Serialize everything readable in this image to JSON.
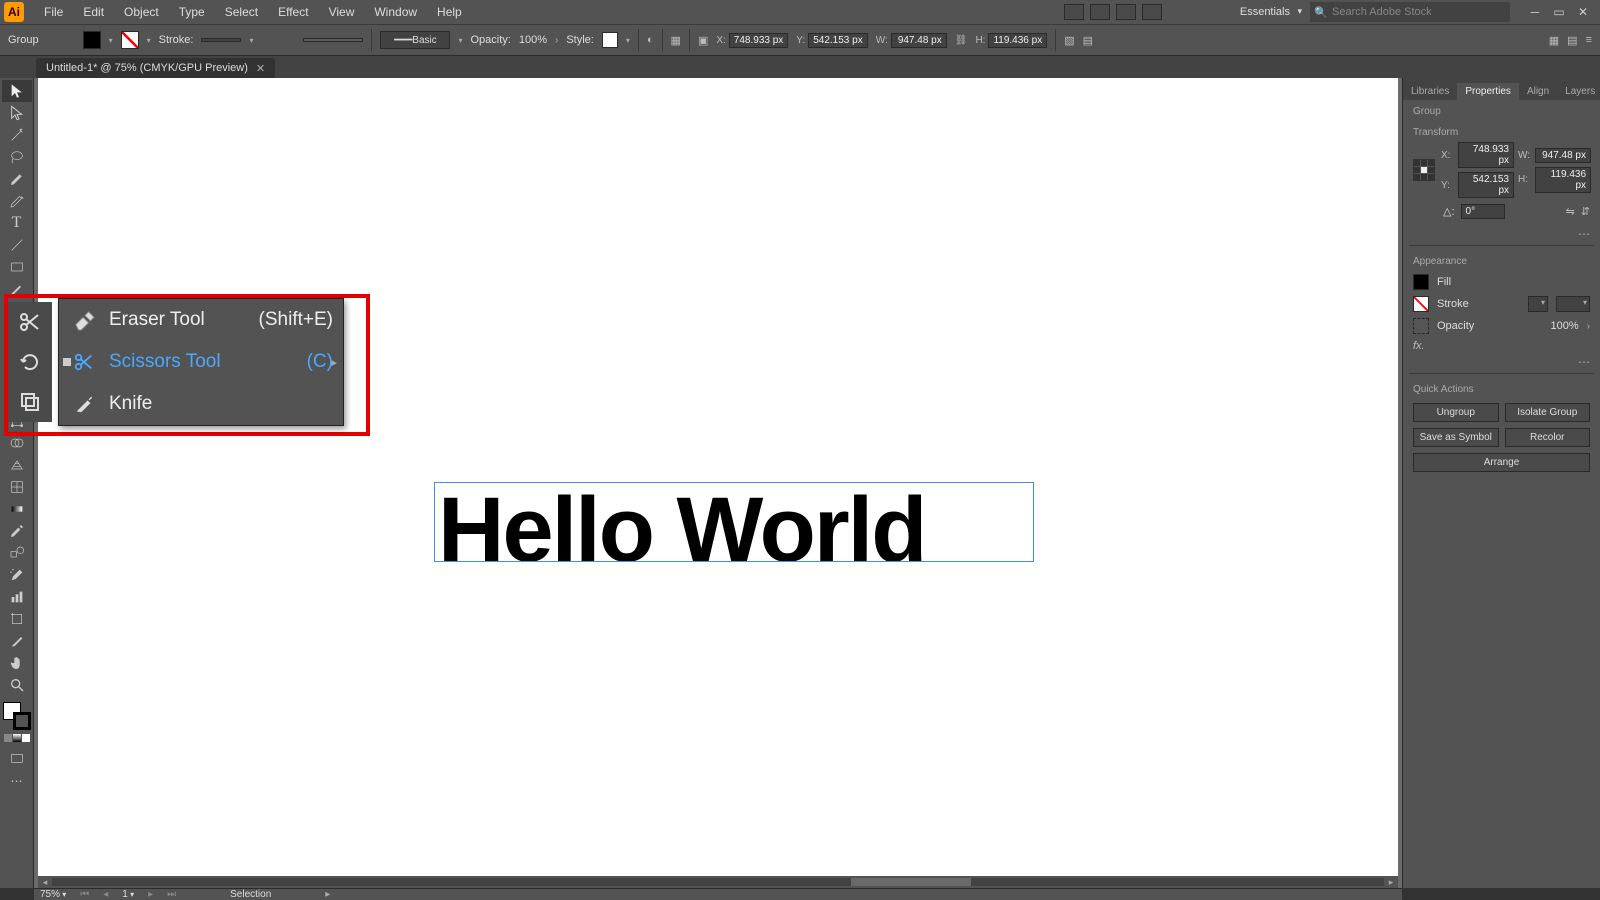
{
  "app_short": "Ai",
  "menu": [
    "File",
    "Edit",
    "Object",
    "Type",
    "Select",
    "Effect",
    "View",
    "Window",
    "Help"
  ],
  "workspace": "Essentials",
  "search_placeholder": "Search Adobe Stock",
  "control": {
    "selection_label": "Group",
    "stroke_label": "Stroke:",
    "stroke_weight": "",
    "brush_basic": "Basic",
    "opacity_label": "Opacity:",
    "opacity_value": "100%",
    "style_label": "Style:",
    "x_label": "X:",
    "y_label": "Y:",
    "w_label": "W:",
    "h_label": "H:",
    "x": "748.933 px",
    "y": "542.153 px",
    "w": "947.48 px",
    "h": "119.436 px"
  },
  "doc_tab": {
    "title": "Untitled-1* @ 75% (CMYK/GPU Preview)"
  },
  "canvas_text": "Hello World",
  "status": {
    "zoom": "75%",
    "artboard_num": "1",
    "tool": "Selection"
  },
  "flyout": {
    "items": [
      {
        "name": "Eraser Tool",
        "shortcut": "(Shift+E)",
        "selected": false,
        "icon": "eraser"
      },
      {
        "name": "Scissors Tool",
        "shortcut": "(C)",
        "selected": true,
        "icon": "scissors"
      },
      {
        "name": "Knife",
        "shortcut": "",
        "selected": false,
        "icon": "knife"
      }
    ]
  },
  "panels": {
    "tabs": [
      "Libraries",
      "Properties",
      "Align",
      "Layers"
    ],
    "active_tab": 1,
    "selection_type": "Group",
    "sec_transform": "Transform",
    "tf": {
      "x_lab": "X:",
      "y_lab": "Y:",
      "w_lab": "W:",
      "h_lab": "H:",
      "x": "748.933 px",
      "y": "542.153 px",
      "w": "947.48 px",
      "h": "119.436 px",
      "angle_lab": "△:",
      "angle": "0°"
    },
    "sec_appearance": "Appearance",
    "fill_label": "Fill",
    "stroke_label": "Stroke",
    "opacity_label": "Opacity",
    "opacity_value": "100%",
    "sec_quick": "Quick Actions",
    "qa": [
      "Ungroup",
      "Isolate Group",
      "Save as Symbol",
      "Recolor",
      "Arrange"
    ]
  }
}
